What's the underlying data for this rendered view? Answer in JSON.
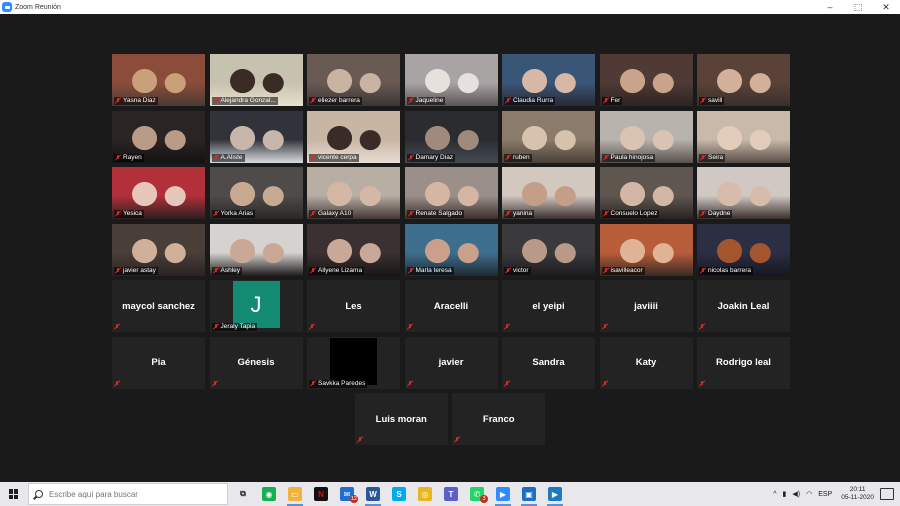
{
  "window": {
    "title": "Zoom Reunión",
    "controls": [
      "–",
      "⬚",
      "✕"
    ]
  },
  "gallery": {
    "rows": [
      [
        {
          "name": "Yasna Diaz",
          "video": true,
          "colors": [
            "#8b4d3a",
            "#c9a07a",
            "#4b3a33"
          ]
        },
        {
          "name": "Alejandra Gonzal...",
          "video": true,
          "active": true,
          "colors": [
            "#c7c1b0",
            "#3b2b25",
            "#e8e0cf"
          ]
        },
        {
          "name": "eliezer barrera",
          "video": true,
          "colors": [
            "#6a5a54",
            "#c9b3a2",
            "#3b3536"
          ]
        },
        {
          "name": "Jaqueline",
          "video": true,
          "colors": [
            "#a9a4a4",
            "#e7e1de",
            "#5c5458"
          ]
        },
        {
          "name": "Claudia Rurra",
          "video": true,
          "colors": [
            "#3a5676",
            "#d7b8a6",
            "#2a2a35"
          ]
        },
        {
          "name": "Fer",
          "video": true,
          "colors": [
            "#4f3a35",
            "#caa48a",
            "#2c2424"
          ]
        },
        {
          "name": "savill",
          "video": true,
          "colors": [
            "#5a4238",
            "#d3b09a",
            "#3b2e2c"
          ]
        }
      ],
      [
        {
          "name": "Rayen",
          "video": true,
          "colors": [
            "#2b2424",
            "#b99b87",
            "#141212"
          ]
        },
        {
          "name": "A.Aliste",
          "video": true,
          "colors": [
            "#30343a",
            "#c7b6a9",
            "#d8dbe0"
          ]
        },
        {
          "name": "vicente cerpa",
          "video": true,
          "colors": [
            "#c8b6a5",
            "#3a2b28",
            "#e8ddd4"
          ]
        },
        {
          "name": "Damary Diaz",
          "video": true,
          "colors": [
            "#2a2c30",
            "#9f8a7c",
            "#454a52"
          ]
        },
        {
          "name": "ruben",
          "video": true,
          "colors": [
            "#8a7b6a",
            "#d6c2ad",
            "#4a4038"
          ]
        },
        {
          "name": "Paula hinojosa",
          "video": true,
          "colors": [
            "#b9b3ad",
            "#d9c3b2",
            "#58504b"
          ]
        },
        {
          "name": "Seira",
          "video": true,
          "colors": [
            "#c8b9aa",
            "#e2cdbd",
            "#5a4d45"
          ]
        }
      ],
      [
        {
          "name": "Yesica",
          "video": true,
          "colors": [
            "#b1303a",
            "#e6c7b9",
            "#2b1f1f"
          ]
        },
        {
          "name": "Yorka Arias",
          "video": true,
          "colors": [
            "#4f4b4a",
            "#c8a992",
            "#2a2727"
          ]
        },
        {
          "name": "Galaxy A10",
          "video": true,
          "colors": [
            "#b9aea4",
            "#d5b7a6",
            "#433734"
          ]
        },
        {
          "name": "Renate Salgado",
          "video": true,
          "colors": [
            "#9b8f8a",
            "#d5b6a3",
            "#3b2f2c"
          ]
        },
        {
          "name": "yanina",
          "video": true,
          "colors": [
            "#d2c8c0",
            "#c49e86",
            "#3a3030"
          ]
        },
        {
          "name": "Consuelo Lopez",
          "video": true,
          "colors": [
            "#5f574f",
            "#d3b6a5",
            "#2a2222"
          ]
        },
        {
          "name": "Daydne",
          "video": true,
          "colors": [
            "#cfc8c3",
            "#d8bcab",
            "#3a302e"
          ]
        }
      ],
      [
        {
          "name": "javier astay",
          "video": true,
          "colors": [
            "#4a3e38",
            "#d1b09a",
            "#2a2322"
          ]
        },
        {
          "name": "Ashley",
          "video": true,
          "colors": [
            "#d6d2cf",
            "#caa896",
            "#1f1b1b"
          ]
        },
        {
          "name": "Allyene Lizama",
          "video": true,
          "colors": [
            "#3b3132",
            "#c9a897",
            "#1a1515"
          ]
        },
        {
          "name": "Marla teresa",
          "video": true,
          "colors": [
            "#3e6e8e",
            "#caa08a",
            "#1f2a33"
          ]
        },
        {
          "name": "victor",
          "video": true,
          "colors": [
            "#3a3a3c",
            "#b99a88",
            "#1c1c1e"
          ]
        },
        {
          "name": "isavilleacor",
          "video": true,
          "colors": [
            "#b85d3a",
            "#e0b396",
            "#3a2a24"
          ]
        },
        {
          "name": "nicolas barrera",
          "video": true,
          "colors": [
            "#2c2f44",
            "#a5552e",
            "#15161f"
          ]
        }
      ],
      [
        {
          "name": "maycol sanchez",
          "video": false
        },
        {
          "name": "Jeraly Tapia",
          "video": false,
          "avatar": {
            "letter": "J",
            "color": "#138a72"
          }
        },
        {
          "name": "Les",
          "video": false
        },
        {
          "name": "Aracelli",
          "video": false
        },
        {
          "name": "el yeipi",
          "video": false
        },
        {
          "name": "javiiii",
          "video": false
        },
        {
          "name": "Joakin Leal",
          "video": false
        }
      ],
      [
        {
          "name": "Pia",
          "video": false
        },
        {
          "name": "Génesis",
          "video": false
        },
        {
          "name": "Savkka Paredes",
          "video": false,
          "avatar": {
            "letter": "",
            "color": "#000000"
          }
        },
        {
          "name": "javier",
          "video": false
        },
        {
          "name": "Sandra",
          "video": false
        },
        {
          "name": "Katy",
          "video": false
        },
        {
          "name": "Rodrigo leal",
          "video": false
        }
      ],
      [
        {
          "name": "Luis moran",
          "video": false
        },
        {
          "name": "Franco",
          "video": false
        }
      ]
    ]
  },
  "taskbar": {
    "search_placeholder": "Escribe aquí para buscar",
    "apps": [
      {
        "name": "task-view-icon",
        "color": "#e8e8ec",
        "glyph": "⧉",
        "text_color": "#222"
      },
      {
        "name": "green-app-icon",
        "color": "#16b14e",
        "glyph": "◉"
      },
      {
        "name": "file-explorer-icon",
        "color": "#f2b33d",
        "glyph": "▭",
        "open": true
      },
      {
        "name": "netflix-icon",
        "color": "#111111",
        "glyph": "N",
        "text_color": "#e50914"
      },
      {
        "name": "mail-icon",
        "color": "#1f6fd1",
        "glyph": "✉",
        "badge": "12"
      },
      {
        "name": "word-icon",
        "color": "#2b5797",
        "glyph": "W",
        "open": true
      },
      {
        "name": "skype-icon",
        "color": "#00a9f0",
        "glyph": "S"
      },
      {
        "name": "chrome-icon",
        "color": "#e8b71c",
        "glyph": "◎"
      },
      {
        "name": "teams-icon",
        "color": "#5b5fc7",
        "glyph": "T"
      },
      {
        "name": "whatsapp-icon",
        "color": "#25d366",
        "glyph": "✆",
        "badge": "3"
      },
      {
        "name": "zoom-icon",
        "color": "#2d8cff",
        "glyph": "▶",
        "open": true
      },
      {
        "name": "photos-icon",
        "color": "#1b6fc2",
        "glyph": "▣",
        "open": true
      },
      {
        "name": "media-player-icon",
        "color": "#1a7bc4",
        "glyph": "▶",
        "open": true
      }
    ],
    "tray": {
      "chevron": "^",
      "lang": "ESP",
      "time": "20:11",
      "date": "05-11-2020"
    }
  }
}
